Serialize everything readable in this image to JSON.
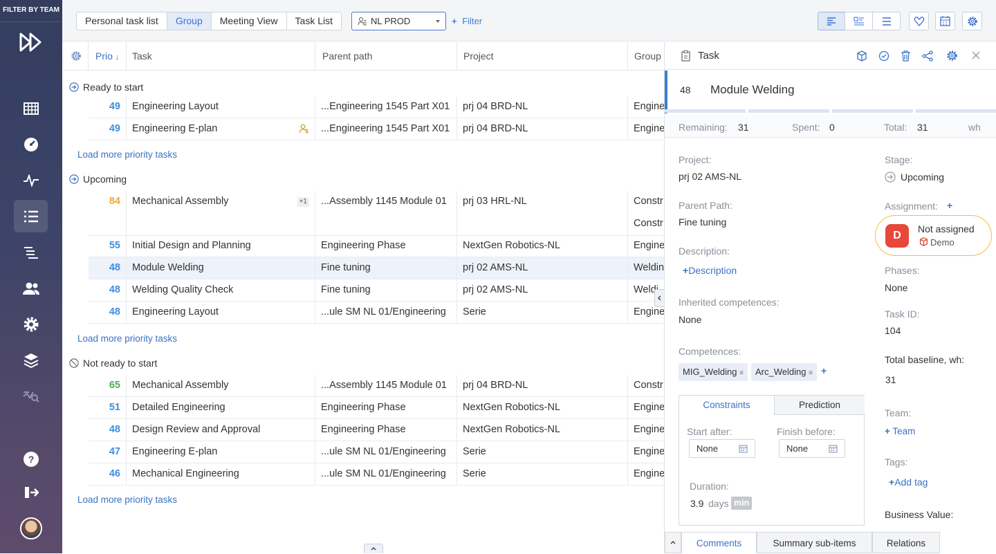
{
  "sidebar": {
    "filter_label": "FILTER BY TEAM",
    "icons": [
      "logo-forward-icon",
      "calendar-grid-icon",
      "dashboard-gauge-icon",
      "activity-pulse-icon",
      "task-list-icon",
      "gantt-list-icon",
      "users-icon",
      "gear-icon",
      "layers-icon",
      "analytics-icon",
      "help-icon",
      "logout-icon"
    ]
  },
  "topbar": {
    "tabs": [
      "Personal task list",
      "Group",
      "Meeting View",
      "Task List"
    ],
    "active_tab": "Group",
    "team_select": "NL PROD",
    "filter_label": "Filter"
  },
  "grid": {
    "headers": {
      "prio": "Prio",
      "task": "Task",
      "path": "Parent path",
      "project": "Project",
      "group": "Group"
    },
    "sections": [
      {
        "title": "Ready to start",
        "rows": [
          {
            "prio": "49",
            "color": "#3b8fe0",
            "task": "Engineering Layout",
            "path": "...Engineering 1545 Part X01",
            "project": "prj 04 BRD-NL",
            "group": "Engine"
          },
          {
            "prio": "49",
            "color": "#3b8fe0",
            "task": "Engineering E-plan",
            "path": "...Engineering 1545 Part X01",
            "project": "prj 04 BRD-NL",
            "group": "Engine"
          }
        ]
      },
      {
        "title": "Upcoming",
        "rows": [
          {
            "prio": "84",
            "color": "#f0a830",
            "task": "Mechanical Assembly",
            "badge": "+1",
            "path": "...Assembly 1145 Module 01",
            "project": "prj 03 HRL-NL",
            "group": "Constr",
            "group2": "Constr"
          },
          {
            "prio": "55",
            "color": "#3b8fe0",
            "task": "Initial Design and Planning",
            "path": "Engineering Phase",
            "project": "NextGen Robotics-NL",
            "group": "Engine"
          },
          {
            "prio": "48",
            "color": "#3b8fe0",
            "task": "Module Welding",
            "path": "Fine tuning",
            "project": "prj 02 AMS-NL",
            "group": "Weldin"
          },
          {
            "prio": "48",
            "color": "#3b8fe0",
            "task": "Welding Quality Check",
            "path": "Fine tuning",
            "project": "prj 02 AMS-NL",
            "group": "Weldi"
          },
          {
            "prio": "48",
            "color": "#3b8fe0",
            "task": "Engineering Layout",
            "path": "...ule SM NL 01/Engineering",
            "project": "Serie",
            "group": "Engine"
          }
        ]
      },
      {
        "title": "Not ready to start",
        "rows": [
          {
            "prio": "65",
            "color": "#4caf50",
            "task": "Mechanical Assembly",
            "path": "...Assembly 1145 Module 01",
            "project": "prj 04 BRD-NL",
            "group": "Constr"
          },
          {
            "prio": "51",
            "color": "#3b8fe0",
            "task": "Detailed Engineering",
            "path": "Engineering Phase",
            "project": "NextGen Robotics-NL",
            "group": "Engine"
          },
          {
            "prio": "48",
            "color": "#3b8fe0",
            "task": "Design Review and Approval",
            "path": "Engineering Phase",
            "project": "NextGen Robotics-NL",
            "group": "Engine"
          },
          {
            "prio": "47",
            "color": "#3b8fe0",
            "task": "Engineering E-plan",
            "path": "...ule SM NL 01/Engineering",
            "project": "Serie",
            "group": "Engine"
          },
          {
            "prio": "46",
            "color": "#3b8fe0",
            "task": "Mechanical Engineering",
            "path": "...ule SM NL 01/Engineering",
            "project": "Serie",
            "group": "Engine"
          }
        ]
      }
    ],
    "load_more": "Load more priority tasks"
  },
  "panel": {
    "header": "Task",
    "task_number": "48",
    "task_title": "Module Welding",
    "remaining_label": "Remaining:",
    "remaining": "31",
    "spent_label": "Spent:",
    "spent": "0",
    "total_label": "Total:",
    "total": "31",
    "unit": "wh",
    "project_label": "Project:",
    "project": "prj 02 AMS-NL",
    "parent_label": "Parent Path:",
    "parent": "Fine tuning",
    "description_label": "Description:",
    "description_add": "Description",
    "inherited_label": "Inherited competences:",
    "inherited": "None",
    "competences_label": "Competences:",
    "competences": [
      "MIG_Welding",
      "Arc_Welding"
    ],
    "stage_label": "Stage:",
    "stage": "Upcoming",
    "assignment_label": "Assignment:",
    "assignee_initial": "D",
    "assignee": "Not assigned",
    "assignee_project": "Demo",
    "phases_label": "Phases:",
    "phases": "None",
    "taskid_label": "Task ID:",
    "taskid": "104",
    "baseline_label": "Total baseline, wh:",
    "baseline": "31",
    "team_label": "Team:",
    "team_add": "Team",
    "tags_label": "Tags:",
    "tags_add": "Add tag",
    "business_label": "Business Value:",
    "tab_constraints": "Constraints",
    "tab_prediction": "Prediction",
    "start_label": "Start after:",
    "start_val": "None",
    "finish_label": "Finish before:",
    "finish_val": "None",
    "duration_label": "Duration:",
    "duration_val": "3.9",
    "duration_unit": "days",
    "duration_badge": "min",
    "bottom_tabs": [
      "Comments",
      "Summary sub-items",
      "Relations"
    ]
  }
}
